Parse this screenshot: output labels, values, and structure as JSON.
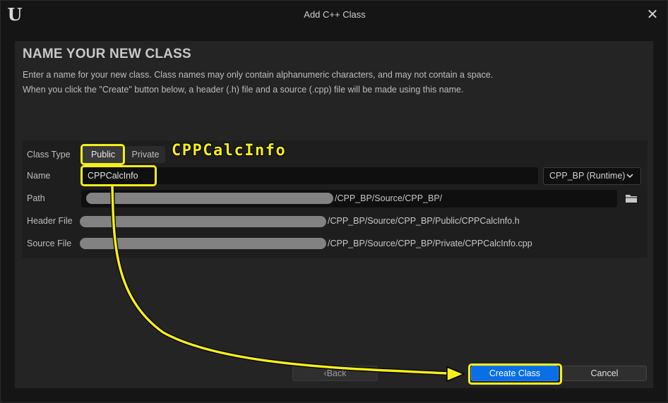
{
  "window": {
    "title": "Add C++ Class",
    "logo_icon": "unreal-engine-logo",
    "logo_text": "U",
    "close_glyph": "✕"
  },
  "header": {
    "heading": "NAME YOUR NEW CLASS",
    "description_line1": "Enter a name for your new class. Class names may only contain alphanumeric characters, and may not contain a space.",
    "description_line2": "When you click the \"Create\" button below, a header (.h) file and a source (.cpp) file will be made using this name."
  },
  "form": {
    "class_type_label": "Class Type",
    "class_type_options": [
      "Public",
      "Private"
    ],
    "class_type_selected": "Public",
    "name_label": "Name",
    "name_value": "CPPCalcInfo",
    "module_value": "CPP_BP (Runtime)",
    "path_label": "Path",
    "path_value": "/CPP_BP/Source/CPP_BP/",
    "header_file_label": "Header File",
    "header_file_value": "/CPP_BP/Source/CPP_BP/Public/CPPCalcInfo.h",
    "source_file_label": "Source File",
    "source_file_value": "/CPP_BP/Source/CPP_BP/Private/CPPCalcInfo.cpp"
  },
  "annotation": {
    "text": "CPPCalcInfo",
    "color": "#f5ee1a"
  },
  "footer": {
    "back_label": "Back",
    "back_glyph": "‹",
    "create_label": "Create Class",
    "cancel_label": "Cancel"
  },
  "colors": {
    "accent": "#0a6ee6",
    "highlight": "#f5ee1a"
  }
}
